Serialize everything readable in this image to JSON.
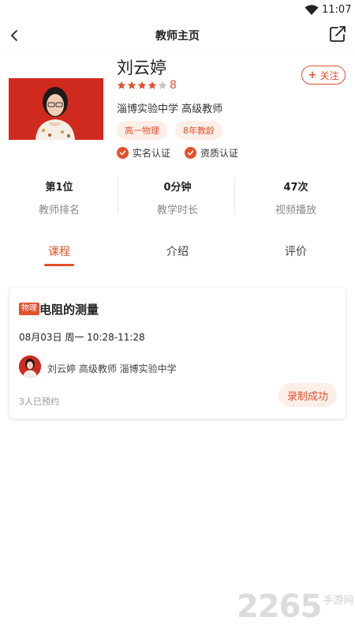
{
  "status_bar": {
    "time": "11:07"
  },
  "header": {
    "title": "教师主页"
  },
  "profile": {
    "name": "刘云婷",
    "rating": "8",
    "stars_filled": 4,
    "stars_total": 5,
    "follow_label": "关注",
    "school_line": "淄博实验中学  高级教师",
    "tags": [
      "高一物理",
      "8年教龄"
    ],
    "certs": [
      "实名认证",
      "资质认证"
    ]
  },
  "stats": [
    {
      "value": "第1位",
      "label": "教师排名"
    },
    {
      "value": "0分钟",
      "label": "教学时长"
    },
    {
      "value": "47次",
      "label": "视频播放"
    }
  ],
  "tabs": [
    "课程",
    "介绍",
    "评价"
  ],
  "active_tab": "课程",
  "course": {
    "subject": "物理",
    "title": "电阻的测量",
    "time": "08月03日 周一 10:28-11:28",
    "teacher_line": "刘云婷   高级教师   淄博实验中学",
    "booked": "3人已预约",
    "status": "录制成功"
  },
  "watermark": {
    "number": "2265",
    "suffix": "手游网"
  },
  "colors": {
    "accent": "#e2512c",
    "accent_light": "#fdeee8",
    "photo_bg": "#d02a1f"
  }
}
